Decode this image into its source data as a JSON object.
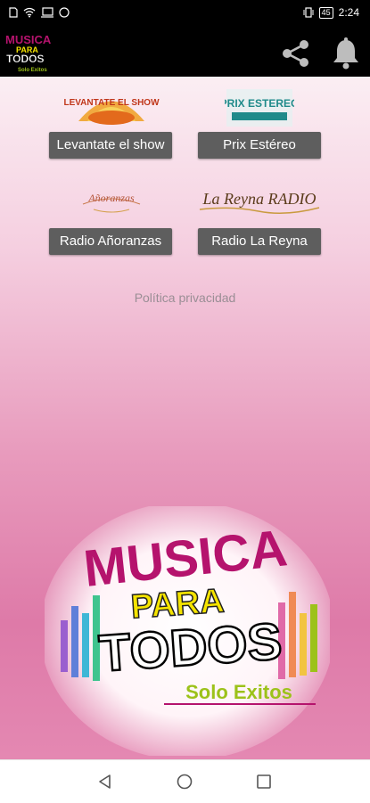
{
  "status_bar": {
    "time": "2:24",
    "battery": "45",
    "icons_left": [
      "sim-icon",
      "wifi-icon",
      "cast-icon",
      "dnd-icon"
    ],
    "icons_right": [
      "vibrate-icon"
    ]
  },
  "app_bar": {
    "logo_text": [
      "MUSICA",
      "PARA",
      "TODOS",
      "Solo Exitos"
    ],
    "actions": [
      "share-icon",
      "bell-icon"
    ]
  },
  "stations": [
    {
      "logo_text": "LEVANTATE EL SHOW",
      "label": "Levantate el show"
    },
    {
      "logo_text": "PRIX ESTEREO",
      "label": "Prix Estéreo"
    },
    {
      "logo_text": "Añoranzas",
      "label": "Radio Añoranzas"
    },
    {
      "logo_text": "La Reyna RADIO",
      "label": "Radio La Reyna"
    }
  ],
  "privacy_link": "Política privacidad",
  "banner": {
    "line1": "MUSICA",
    "line2": "PARA",
    "line3": "TODOS",
    "line4": "Solo Exitos"
  },
  "colors": {
    "accent_magenta": "#b5136d",
    "yellow": "#f5e400",
    "green": "#9cc21a",
    "button_gray": "#5e5e5e"
  },
  "nav_bar": [
    "back-icon",
    "home-icon",
    "recents-icon"
  ]
}
